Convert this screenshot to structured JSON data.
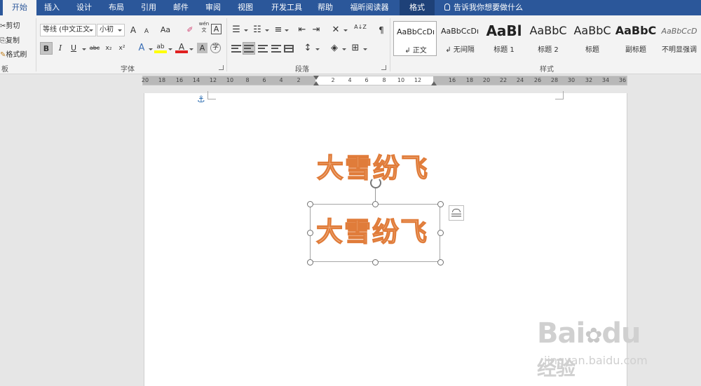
{
  "tabs": [
    {
      "label": "开始",
      "active": true
    },
    {
      "label": "插入"
    },
    {
      "label": "设计"
    },
    {
      "label": "布局"
    },
    {
      "label": "引用"
    },
    {
      "label": "邮件"
    },
    {
      "label": "审阅"
    },
    {
      "label": "视图"
    },
    {
      "label": "开发工具"
    },
    {
      "label": "帮助"
    },
    {
      "label": "福昕阅读器"
    },
    {
      "label": "格式",
      "contextual": true
    }
  ],
  "tell_me": "告诉我你想要做什么",
  "clipboard": {
    "cut": "剪切",
    "copy": "复制",
    "format_painter": "格式刷",
    "label": "板"
  },
  "font": {
    "family": "等线 (中文正文",
    "size": "小初",
    "label": "字体",
    "case_button": "Aa",
    "phonetic_top": "wén",
    "phonetic_bottom": "文",
    "border_char": "A",
    "shade_char": "A",
    "enclose_char": "字",
    "bold": "B",
    "italic": "I",
    "underline": "U",
    "strike": "abc",
    "subscript": "x₂",
    "superscript": "x²",
    "grow": "A",
    "shrink": "A",
    "highlight": "ab",
    "font_color": "A"
  },
  "paragraph": {
    "label": "段落",
    "sort": "A↓Z"
  },
  "styles": {
    "label": "样式",
    "items": [
      {
        "sample": "AaBbCcDı",
        "name": "正文",
        "active": true
      },
      {
        "sample": "AaBbCcDı",
        "name": "无间隔"
      },
      {
        "sample": "AaBl",
        "name": "标题 1"
      },
      {
        "sample": "AaBbC",
        "name": "标题 2"
      },
      {
        "sample": "AaBbC",
        "name": "标题"
      },
      {
        "sample": "AaBbC",
        "name": "副标题"
      },
      {
        "sample": "AaBbCcD",
        "name": "不明显强调"
      }
    ]
  },
  "ruler": {
    "left": [
      "20",
      "18",
      "16",
      "14",
      "12",
      "10",
      "8",
      "6",
      "4",
      "2"
    ],
    "right": [
      "2",
      "4",
      "6",
      "8",
      "10",
      "12",
      "16",
      "18",
      "20",
      "22",
      "24",
      "26",
      "28",
      "30",
      "32",
      "34",
      "36"
    ]
  },
  "document": {
    "wordart_top": "大雪纷飞",
    "wordart_box": "大雪纷飞"
  },
  "watermark": {
    "logo": "Bai",
    "logo2": "du",
    "brand": "经验",
    "url": "jingyan.baidu.com"
  },
  "colors": {
    "tab_bar": "#2b579a",
    "wordart_fill": "#f8cba8",
    "wordart_stroke": "#e07c3a",
    "highlight": "#ffff00",
    "font_color": "#e02020"
  }
}
